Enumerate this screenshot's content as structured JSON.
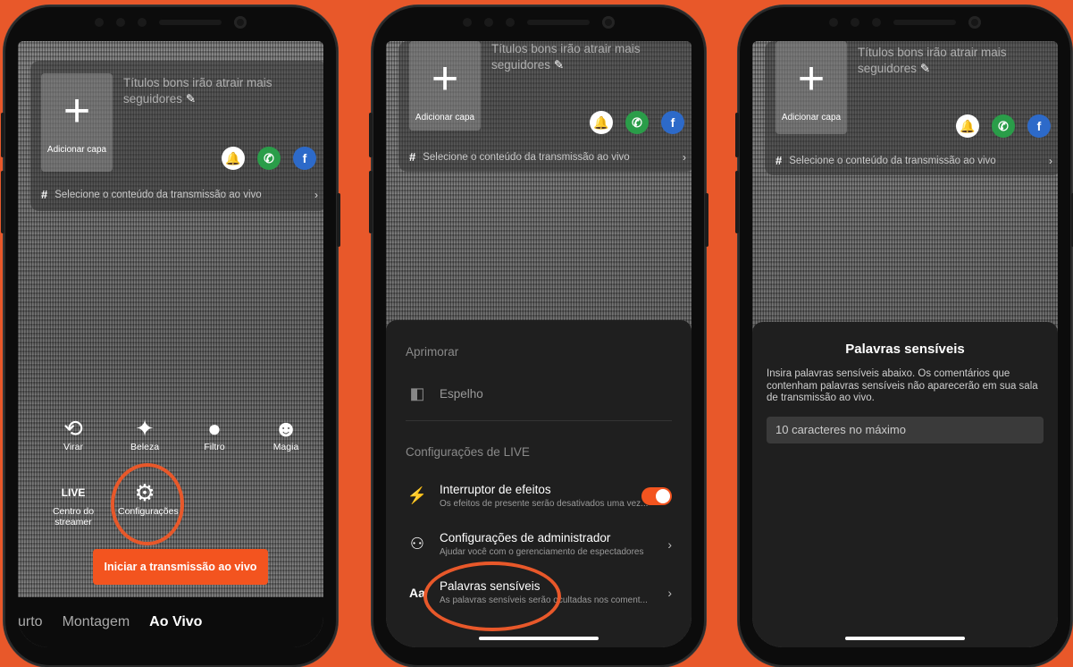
{
  "phone1": {
    "cover_plus": "+",
    "cover_label": "Adicionar capa",
    "title_placeholder": "Títulos bons irão atrair mais seguidores",
    "edit_icon": "✎",
    "content_label": "Selecione o conteúdo da transmissão ao vivo",
    "tools": [
      {
        "label": "Virar",
        "icon": "camera-flip-icon"
      },
      {
        "label": "Beleza",
        "icon": "beauty-wand-icon"
      },
      {
        "label": "Filtro",
        "icon": "filter-icon"
      },
      {
        "label": "Magia",
        "icon": "magic-face-icon"
      },
      {
        "label": "Centro do streamer",
        "icon": "live-center-icon"
      },
      {
        "label": "Configurações",
        "icon": "gear-icon"
      }
    ],
    "start_button": "Iniciar a transmissão ao vivo",
    "nav": [
      "urto",
      "Montagem",
      "Ao Vivo"
    ]
  },
  "phone2": {
    "cover_plus": "+",
    "cover_label": "Adicionar capa",
    "title_placeholder": "Títulos bons irão atrair mais seguidores",
    "content_label": "Selecione o conteúdo da transmissão ao vivo",
    "section_enhance": "Aprimorar",
    "mirror": "Espelho",
    "section_live": "Configurações de LIVE",
    "effects_title": "Interruptor de efeitos",
    "effects_sub": "Os efeitos de presente serão desativados uma vez...",
    "admin_title": "Configurações de administrador",
    "admin_sub": "Ajudar você com o gerenciamento de espectadores",
    "sensitive_title": "Palavras sensíveis",
    "sensitive_sub": "As palavras sensíveis serão ocultadas nos coment..."
  },
  "phone3": {
    "cover_plus": "+",
    "cover_label": "Adicionar capa",
    "title_placeholder": "Títulos bons irão atrair mais seguidores",
    "content_label": "Selecione o conteúdo da transmissão ao vivo",
    "sheet_title": "Palavras sensíveis",
    "sheet_desc": "Insira palavras sensíveis abaixo. Os comentários que contenham palavras sensíveis não aparecerão em sua sala de transmissão ao vivo.",
    "input_placeholder": "10 caracteres no máximo"
  },
  "colors": {
    "background": "#e8582a",
    "accent": "#f3541f"
  }
}
